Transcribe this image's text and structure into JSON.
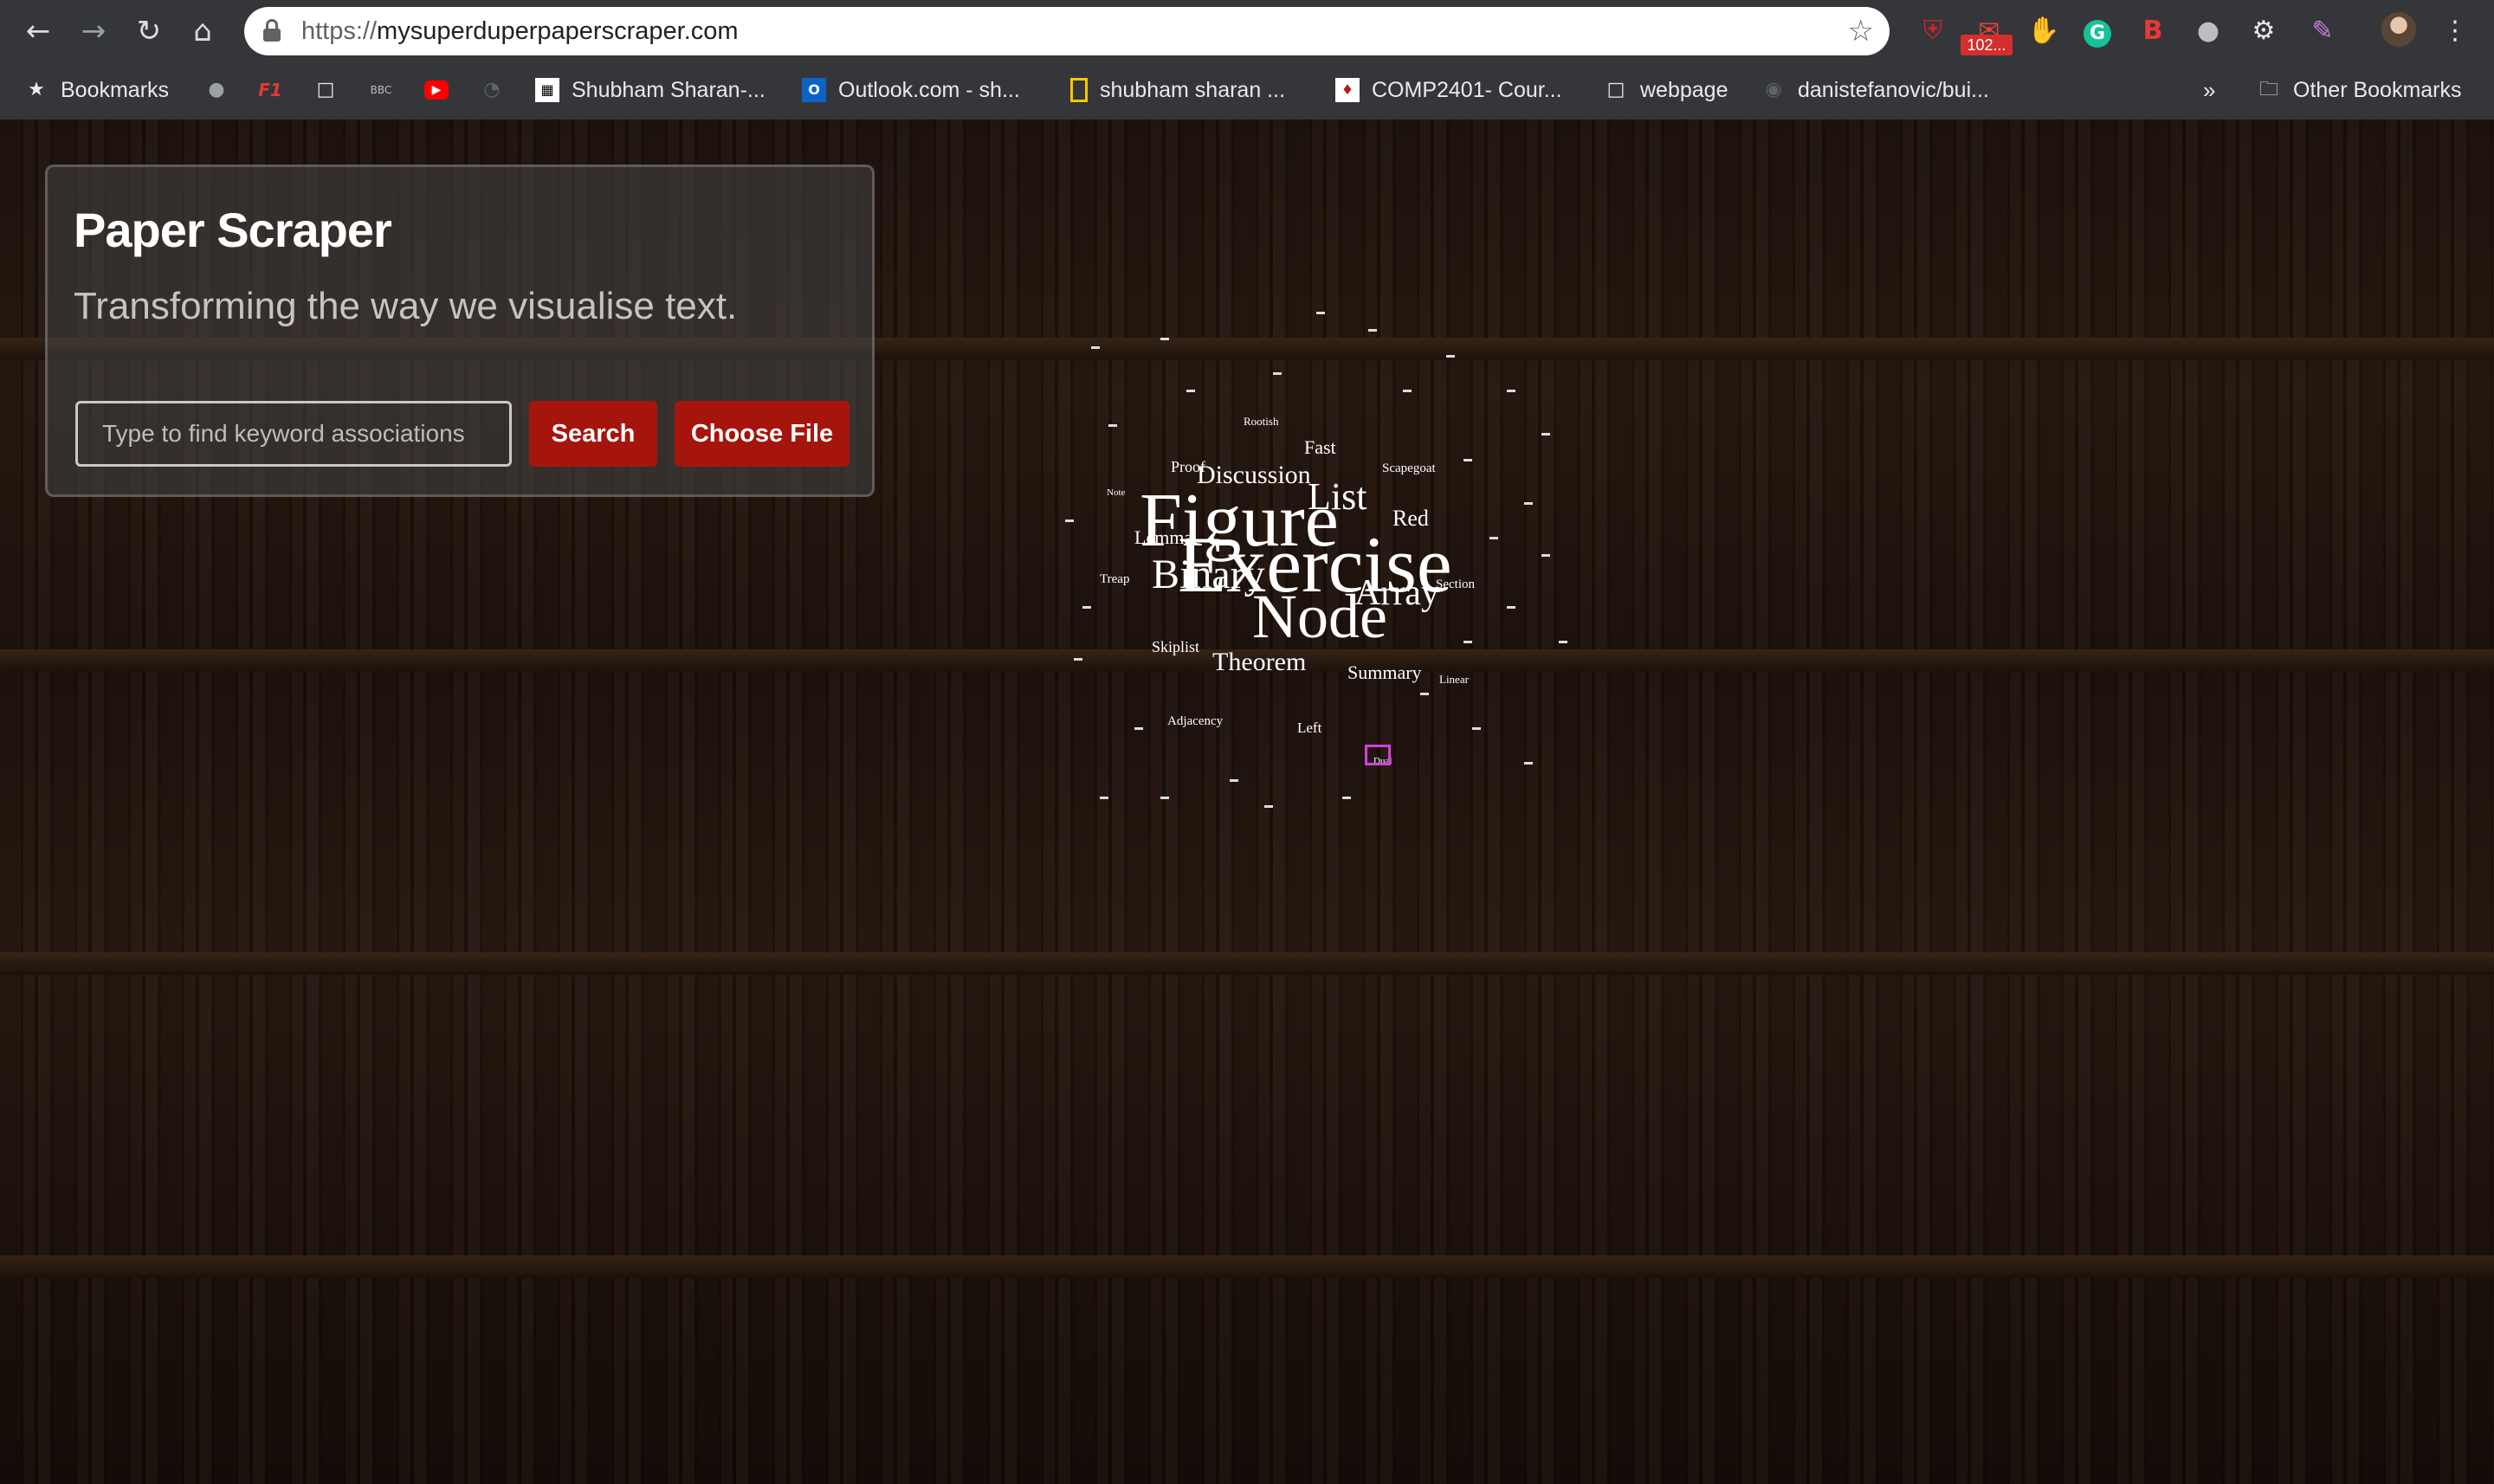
{
  "browser": {
    "url_scheme": "https://",
    "url_host": "mysuperduperpaperscraper.com",
    "gmail_badge": "102...",
    "nav_icons": [
      "back-icon",
      "forward-icon",
      "reload-icon",
      "home-icon"
    ],
    "extension_icons": [
      "ublock-icon",
      "gmail-icon",
      "hand-icon",
      "grammarly-icon",
      "bitdefender-icon",
      "bulb-icon",
      "extension-icon",
      "pen-icon",
      "profile-avatar"
    ]
  },
  "bookmarks": {
    "items": [
      {
        "label": "Bookmarks",
        "icon": "star-icon"
      },
      {
        "label": "",
        "icon": "apple-icon"
      },
      {
        "label": "",
        "icon": "f1-icon"
      },
      {
        "label": "",
        "icon": "page-icon"
      },
      {
        "label": "",
        "icon": "bbc-icon"
      },
      {
        "label": "",
        "icon": "youtube-icon"
      },
      {
        "label": "",
        "icon": "speedometer-icon"
      },
      {
        "label": "Shubham Sharan-...",
        "icon": "grid-icon"
      },
      {
        "label": "Outlook.com - sh...",
        "icon": "outlook-icon"
      },
      {
        "label": "shubham sharan ...",
        "icon": "folder-yellow-icon"
      },
      {
        "label": "COMP2401- Cour...",
        "icon": "crest-icon"
      },
      {
        "label": "webpage",
        "icon": "page-icon"
      },
      {
        "label": "danistefanovic/bui...",
        "icon": "github-icon"
      }
    ],
    "overflow": "»",
    "other": "Other Bookmarks"
  },
  "app": {
    "title": "Paper Scraper",
    "subtitle": "Transforming the way we visualise text.",
    "search_placeholder": "Type to find keyword associations",
    "search_button": "Search",
    "file_button": "Choose File"
  },
  "word_cloud": {
    "words": [
      {
        "text": "Figure",
        "size": 88
      },
      {
        "text": "Exercise",
        "size": 92
      },
      {
        "text": "Node",
        "size": 72
      },
      {
        "text": "Binary",
        "size": 48
      },
      {
        "text": "List",
        "size": 44
      },
      {
        "text": "Array",
        "size": 42
      },
      {
        "text": "Discussion",
        "size": 30
      },
      {
        "text": "Theorem",
        "size": 30
      },
      {
        "text": "Red",
        "size": 26
      },
      {
        "text": "Fast",
        "size": 22
      },
      {
        "text": "Summary",
        "size": 22
      },
      {
        "text": "Lemma",
        "size": 22
      },
      {
        "text": "Proof",
        "size": 18
      },
      {
        "text": "Skiplist",
        "size": 18
      },
      {
        "text": "Scapegoat",
        "size": 15
      },
      {
        "text": "Section",
        "size": 15
      },
      {
        "text": "Treap",
        "size": 15
      },
      {
        "text": "Adjacency",
        "size": 15
      },
      {
        "text": "Left",
        "size": 17
      },
      {
        "text": "Linear",
        "size": 13
      },
      {
        "text": "Rootish",
        "size": 13
      },
      {
        "text": "Note",
        "size": 11
      },
      {
        "text": "Dual",
        "size": 11
      }
    ]
  }
}
